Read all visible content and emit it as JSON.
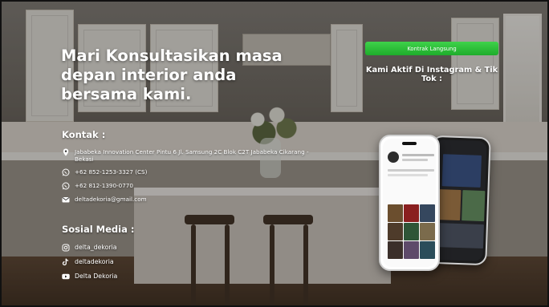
{
  "hero": {
    "headline": "Mari Konsultasikan masa depan interior anda bersama kami."
  },
  "cta": {
    "button_label": "Kontrak Langsung",
    "active_text": "Kami Aktif Di Instagram & Tik Tok :"
  },
  "contact": {
    "title": "Kontak :",
    "items": [
      {
        "icon": "location-pin-icon",
        "text": "Jababeka Innovation Center Pintu 6 Jl. Samsung 2C Blok C2T Jababeka Cikarang - Bekasi"
      },
      {
        "icon": "whatsapp-icon",
        "text": "+62 852-1253-3327 (CS)"
      },
      {
        "icon": "whatsapp-icon",
        "text": "+62 812-1390-0770"
      },
      {
        "icon": "mail-icon",
        "text": "deltadekoria@gmail.com"
      }
    ]
  },
  "social": {
    "title": "Sosial Media :",
    "items": [
      {
        "icon": "instagram-icon",
        "text": "delta_dekoria"
      },
      {
        "icon": "tiktok-icon",
        "text": "deltadekoria"
      },
      {
        "icon": "youtube-icon",
        "text": "Delta Dekoria"
      }
    ]
  },
  "colors": {
    "cta_green": "#22b02e",
    "text": "#ffffff"
  }
}
